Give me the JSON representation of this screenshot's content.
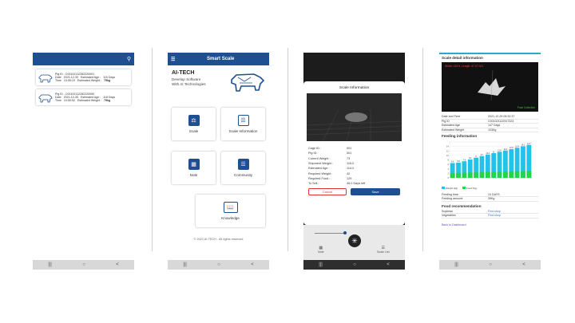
{
  "screen1": {
    "cards": [
      {
        "pig_id_label": "Pig ID :",
        "pig_id": "C00102112282220001",
        "date_label": "Date",
        "date": "2021-12-30",
        "age_label": "Estimated Age :",
        "age": "115 Days",
        "time_label": "Time",
        "time": "10:55:19",
        "weight_label": "Estimated Weight :",
        "weight": "75kg"
      },
      {
        "pig_id_label": "Pig ID :",
        "pig_id": "C00102112282220050",
        "date_label": "Date",
        "date": "2021-12-30",
        "age_label": "Estimated Age :",
        "age": "118 Days",
        "time_label": "Time",
        "time": "10:55:52",
        "weight_label": "Estimated Weight :",
        "weight": "79kg"
      }
    ]
  },
  "screen2": {
    "title": "Smart Scale",
    "brand": "AI-TECH",
    "tagline1": "Develop Software",
    "tagline2": "With AI Technologies",
    "tiles": [
      "Scale",
      "Scale Information",
      "Note",
      "Community",
      "Knowledge"
    ],
    "footer": "© 2021 AI-TECH . All rights reserved"
  },
  "screen3": {
    "title": "Scale Information",
    "rows": [
      {
        "k": "Cage ID :",
        "v": "001"
      },
      {
        "k": "Pig ID :",
        "v": "001"
      },
      {
        "k": "Current Weight :",
        "v": "73"
      },
      {
        "k": "Shipment Weight :",
        "v": "115.0"
      },
      {
        "k": "Estimated Age :",
        "v": "114.0"
      },
      {
        "k": "Required Weight :",
        "v": "42"
      },
      {
        "k": "Required Food :",
        "v": "129"
      },
      {
        "k": "To Sell :",
        "v": "46.0 Days left"
      }
    ],
    "cancel": "Cancel",
    "save": "Save",
    "nav": [
      "Note",
      "Scale List"
    ]
  },
  "screen4": {
    "section1": "Scale detail information",
    "img_caption": "Width: 135 ft, Length: 47.07.021",
    "img_caption2": "Pose Collection",
    "details": [
      {
        "k": "Date and Time",
        "v": "2021-12-29 05:32:37"
      },
      {
        "k": "Pig ID",
        "v": "C001021122917323"
      },
      {
        "k": "Estimated Age",
        "v": "147 Days"
      },
      {
        "k": "Estimated Weight",
        "v": "103Kg"
      }
    ],
    "section2": "Feeding information",
    "legend1": "Weight (kg)",
    "legend2": "Food (Kg)",
    "feeding": [
      {
        "k": "Feeding time:",
        "v": "13 DAYS"
      },
      {
        "k": "Feeding amount:",
        "v": "39Kg"
      }
    ],
    "section3": "Food recommendation",
    "recs": [
      {
        "k": "Soybean",
        "v": "Find shop"
      },
      {
        "k": "Vegetables",
        "v": "Find shop"
      }
    ],
    "back": "Back to Dashboard"
  },
  "chart_data": {
    "type": "bar",
    "series": [
      {
        "name": "Weight (kg)",
        "values": [
          6.6,
          6.8,
          7.4,
          8.2,
          9.0,
          9.7,
          10.4,
          11.0,
          11.6,
          12.2,
          12.8,
          13.4,
          14.1,
          14.7
        ]
      },
      {
        "name": "Food (Kg)",
        "values": [
          2.2,
          2.2,
          2.3,
          2.4,
          2.4,
          2.5,
          2.6,
          2.6,
          2.7,
          2.8,
          2.9,
          3.0,
          3.0,
          3.1
        ]
      }
    ],
    "ylim": [
      0,
      16
    ],
    "yticks": [
      0,
      2,
      4,
      6,
      8,
      10,
      12,
      14
    ],
    "colors": {
      "weight": "#21c4e8",
      "food": "#1ed64a"
    }
  },
  "nav_glyphs": [
    "|||",
    "○",
    "<"
  ]
}
